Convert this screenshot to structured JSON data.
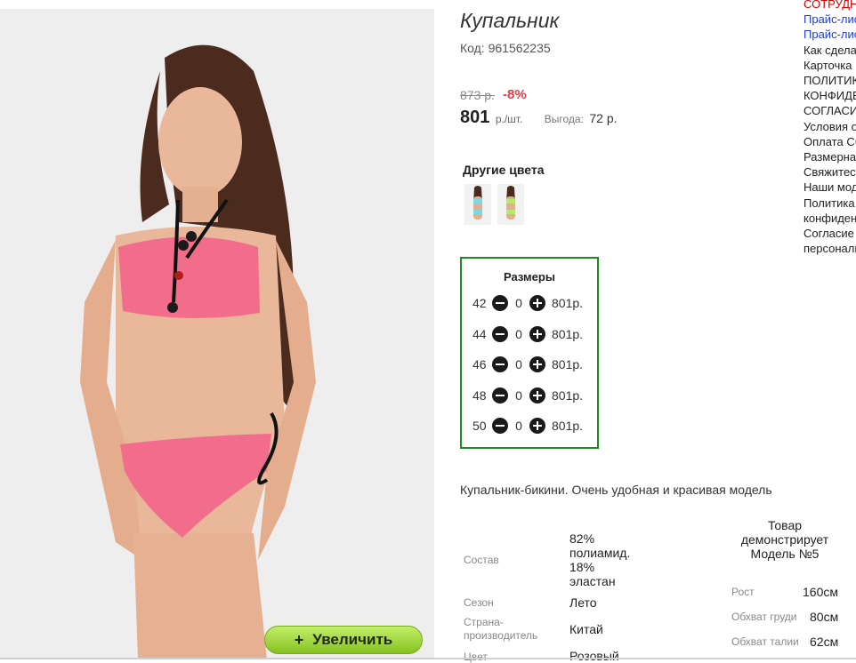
{
  "product": {
    "title": "Купальник",
    "code_label": "Код:",
    "code": "961562235",
    "old_price": "873 р.",
    "discount": "-8%",
    "price": "801",
    "price_unit": "р./шт.",
    "benefit_label": "Выгода:",
    "benefit_value": "72 р.",
    "zoom_label": "Увеличить",
    "description": "Купальник-бикини. Очень удобная и красивая модель"
  },
  "colors": {
    "title": "Другие цвета",
    "swatches": [
      "#7fd8e0",
      "#b9e86e"
    ]
  },
  "sizes": {
    "title": "Размеры",
    "rows": [
      {
        "size": "42",
        "qty": "0",
        "price": "801р."
      },
      {
        "size": "44",
        "qty": "0",
        "price": "801р."
      },
      {
        "size": "46",
        "qty": "0",
        "price": "801р."
      },
      {
        "size": "48",
        "qty": "0",
        "price": "801р."
      },
      {
        "size": "50",
        "qty": "0",
        "price": "801р."
      }
    ]
  },
  "specs": {
    "composition_label": "Состав",
    "composition_lines": [
      "82%",
      "полиамид.",
      "18%",
      "эластан"
    ],
    "season_label": "Сезон",
    "season_value": "Лето",
    "country_label_1": "Страна-",
    "country_label_2": "производитель",
    "country_value": "Китай",
    "color_label": "Цвет",
    "color_value": "Розовый"
  },
  "model": {
    "title_lines": [
      "Товар",
      "демонстрирует",
      "Модель №5"
    ],
    "height_label": "Рост",
    "height_value": "160см",
    "chest_label": "Обхват груди",
    "chest_value": "80см",
    "waist_label": "Обхват талии",
    "waist_value": "62см"
  },
  "sidebar": {
    "links": [
      {
        "text": "СОТРУДНИЧЕСТВО",
        "style": "red"
      },
      {
        "text": "Прайс-лист",
        "style": "blue"
      },
      {
        "text": "Прайс-лист",
        "style": "blue"
      },
      {
        "text": "Как сделать заказ",
        "style": "plain"
      },
      {
        "text": "Карточка",
        "style": "plain"
      },
      {
        "text": "ПОЛИТИКА",
        "style": "plain"
      },
      {
        "text": "КОНФИДЕНЦИАЛЬНОСТИ",
        "style": "plain"
      },
      {
        "text": "СОГЛАСИЕ",
        "style": "plain"
      },
      {
        "text": "Условия оплаты",
        "style": "plain"
      },
      {
        "text": "Оплата Сбербанк",
        "style": "plain"
      },
      {
        "text": "Размерная сетка",
        "style": "plain"
      },
      {
        "text": "Свяжитесь с нами",
        "style": "plain"
      },
      {
        "text": "Наши модели",
        "style": "plain"
      },
      {
        "text": "Политика",
        "style": "plain"
      },
      {
        "text": "конфиденциальности",
        "style": "plain"
      },
      {
        "text": "Согласие на обработку",
        "style": "plain"
      },
      {
        "text": "персональных данных",
        "style": "plain"
      }
    ]
  }
}
